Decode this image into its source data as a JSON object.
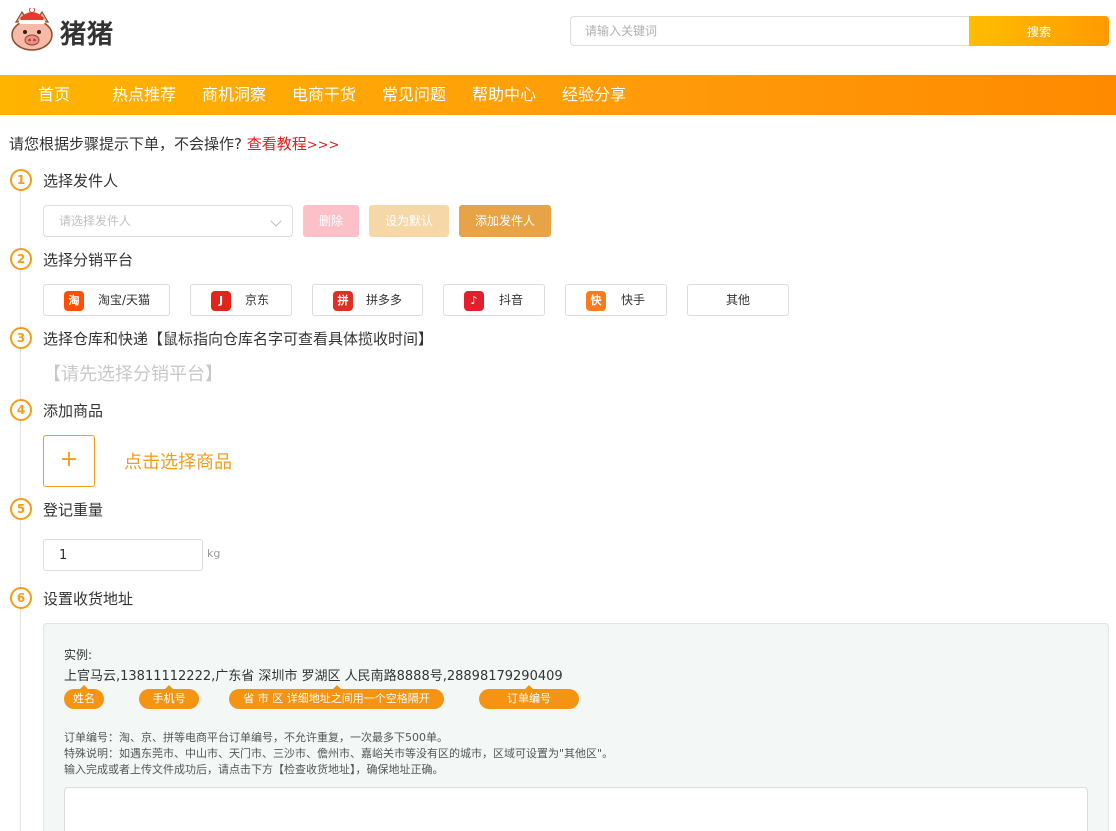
{
  "header": {
    "logo_text": "猪猪",
    "search_placeholder": "请输入关键词",
    "search_button": "搜索"
  },
  "nav": {
    "items": [
      "首页",
      "热点推荐",
      "商机洞察",
      "电商干货",
      "常见问题",
      "帮助中心",
      "经验分享"
    ]
  },
  "notice": {
    "text": "请您根据步骤提示下单，不会操作?",
    "link": "查看教程",
    "link_suffix": ">>>"
  },
  "steps": [
    {
      "num": "1",
      "title": "选择发件人"
    },
    {
      "num": "2",
      "title": "选择分销平台"
    },
    {
      "num": "3",
      "title": "选择仓库和快递【鼠标指向仓库名字可查看具体揽收时间】"
    },
    {
      "num": "4",
      "title": "添加商品"
    },
    {
      "num": "5",
      "title": "登记重量"
    },
    {
      "num": "6",
      "title": "设置收货地址"
    }
  ],
  "sender": {
    "placeholder": "请选择发件人",
    "delete_label": "删除",
    "default_label": "设为默认",
    "add_label": "添加发件人"
  },
  "platforms": [
    {
      "label": "淘宝/天猫",
      "icon": "taobao-icon",
      "glyph": "淘",
      "color": "#ff5000"
    },
    {
      "label": "京东",
      "icon": "jd-icon",
      "glyph": "J",
      "color": "#e1251b"
    },
    {
      "label": "拼多多",
      "icon": "pinduoduo-icon",
      "glyph": "拼",
      "color": "#e02e24"
    },
    {
      "label": "抖音",
      "icon": "douyin-icon",
      "glyph": "♪",
      "color": "#e0202d"
    },
    {
      "label": "快手",
      "icon": "kuaishou-icon",
      "glyph": "快",
      "color": "#ff7a1a"
    },
    {
      "label": "其他",
      "icon": "",
      "glyph": "",
      "color": ""
    }
  ],
  "warehouse": {
    "hint": "【请先选择分销平台】"
  },
  "goods": {
    "add_symbol": "+",
    "add_text": "点击选择商品"
  },
  "weight": {
    "value": "1",
    "unit": "kg"
  },
  "address": {
    "example_label": "实例:",
    "example_line": "上官马云,13811112222,广东省 深圳市 罗湖区 人民南路8888号,28898179290409",
    "tags": [
      "姓名",
      "手机号",
      "省 市 区 详细地址之间用一个空格隔开",
      "订单编号"
    ],
    "notes": [
      "订单编号：淘、京、拼等电商平台订单编号，不允许重复，一次最多下500单。",
      "特殊说明：如遇东莞市、中山市、天门市、三沙市、儋州市、嘉峪关市等没有区的城市，区域可设置为\"其他区\"。",
      "输入完成或者上传文件成功后，请点击下方【检查收货地址】，确保地址正确。"
    ]
  },
  "colors": {
    "accent": "#f59c1a",
    "nav_start": "#ffb400",
    "nav_end": "#ff8a00",
    "link_red": "#e02020"
  }
}
